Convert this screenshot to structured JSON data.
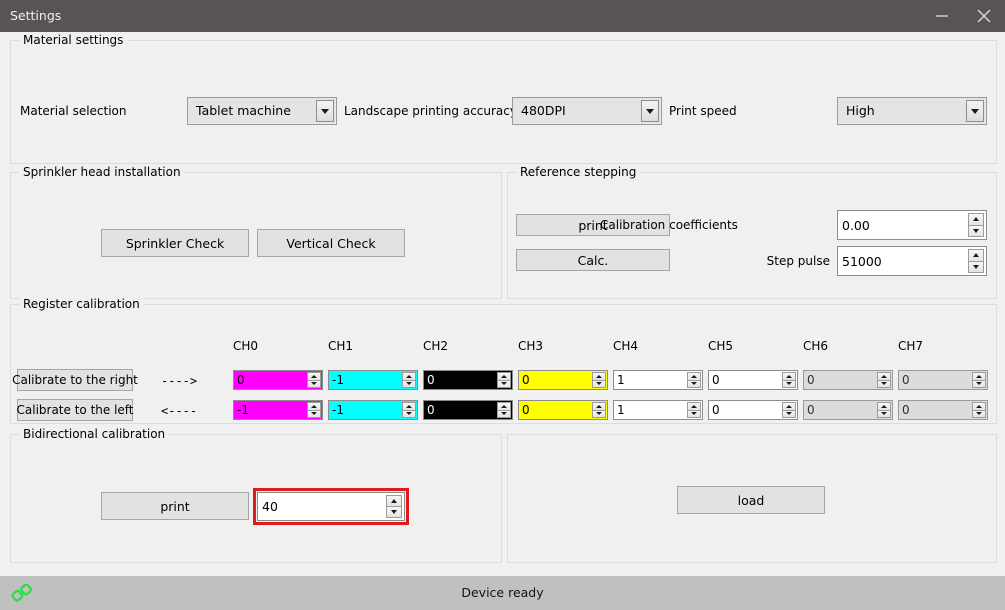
{
  "window": {
    "title": "Settings",
    "minimize_icon": "minimize-icon",
    "close_icon": "close-icon"
  },
  "material_settings": {
    "group_title": "Material settings",
    "material_selection_label": "Material selection",
    "material_selection_value": "Tablet machine",
    "landscape_accuracy_label": "Landscape printing accuracy",
    "landscape_accuracy_value": "480DPI",
    "print_speed_label": "Print speed",
    "print_speed_value": "High"
  },
  "sprinkler": {
    "group_title": "Sprinkler head installation",
    "sprinkler_check_label": "Sprinkler Check",
    "vertical_check_label": "Vertical Check"
  },
  "reference_stepping": {
    "group_title": "Reference stepping",
    "print_label": "print",
    "calc_label": "Calc.",
    "calibration_coefficients_label": "Calibration coefficients",
    "calibration_coefficients_value": "0.00",
    "step_pulse_label": "Step pulse",
    "step_pulse_value": "51000"
  },
  "register_calibration": {
    "group_title": "Register calibration",
    "channels": [
      "CH0",
      "CH1",
      "CH2",
      "CH3",
      "CH4",
      "CH5",
      "CH6",
      "CH7"
    ],
    "right_button_label": "Calibrate to the right",
    "right_arrow": "---->",
    "left_button_label": "Calibrate to the left",
    "left_arrow": "<----",
    "right_values": [
      "0",
      "-1",
      "0",
      "0",
      "1",
      "0",
      "0",
      "0"
    ],
    "left_values": [
      "-1",
      "-1",
      "0",
      "0",
      "1",
      "0",
      "0",
      "0"
    ],
    "channel_colors": [
      "#ff00ff",
      "#00ffff",
      "#000000",
      "#ffff00",
      "#ffffff",
      "#ffffff",
      "#dcdcdc",
      "#dcdcdc"
    ],
    "channel_text_colors": [
      "#000000",
      "#000000",
      "#ffffff",
      "#000000",
      "#000000",
      "#000000",
      "#303030",
      "#303030"
    ],
    "channel_disabled": [
      false,
      false,
      false,
      false,
      false,
      false,
      true,
      true
    ]
  },
  "bidirectional_calibration": {
    "group_title": "Bidirectional calibration",
    "print_label": "print",
    "value": "40",
    "highlight_color": "#e01b1b"
  },
  "load_panel": {
    "load_label": "load"
  },
  "statusbar": {
    "status_text": "Device ready",
    "link_icon": "link-icon",
    "link_icon_color": "#26e03a"
  }
}
